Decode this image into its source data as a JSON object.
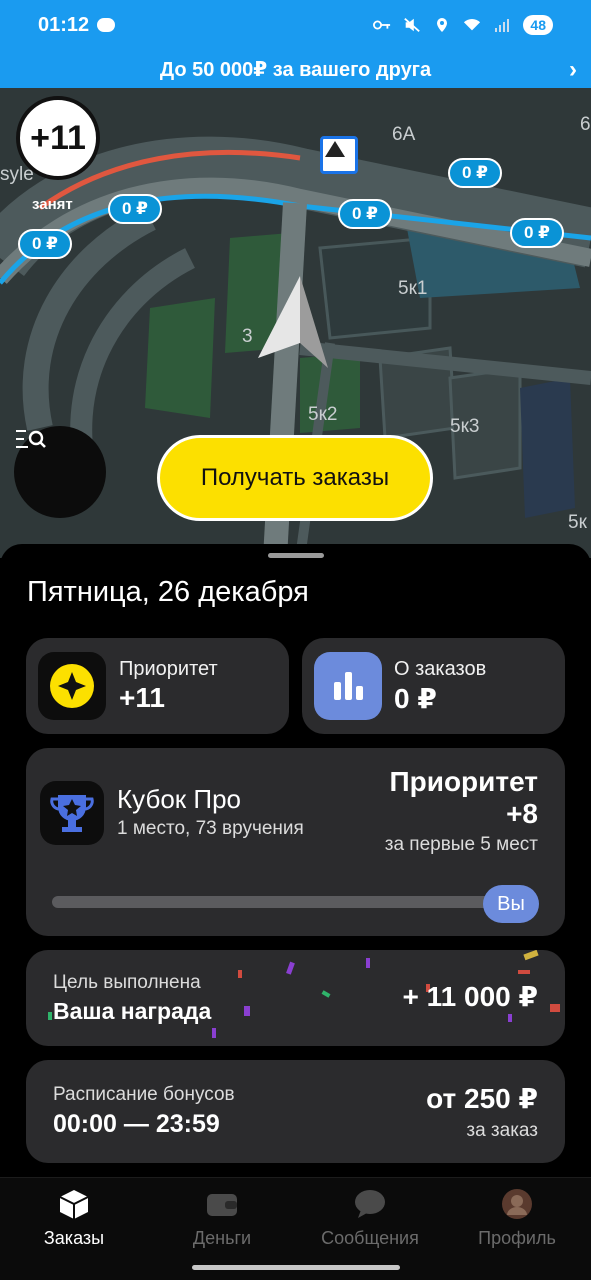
{
  "status_bar": {
    "time": "01:12",
    "battery": "48"
  },
  "promo": {
    "text": "До 50 000₽ за вашего друга"
  },
  "map": {
    "priority_badge": "+11",
    "status_label": "занят",
    "street_labels": [
      "6А",
      "6",
      "5к1",
      "3",
      "5к2",
      "5к3",
      "5к",
      "syle"
    ],
    "price_pills": [
      "0 ₽",
      "0 ₽",
      "0 ₽",
      "0 ₽",
      "0 ₽"
    ],
    "get_orders_button": "Получать заказы"
  },
  "sheet": {
    "date": "Пятница, 26 декабря",
    "priority_card": {
      "label": "Приоритет",
      "value": "+11"
    },
    "orders_card": {
      "label": "О заказов",
      "value": "0 ₽"
    },
    "cup_card": {
      "title": "Кубок Про",
      "subtitle": "1 место, 73 вручения",
      "reward_title": "Приоритет",
      "reward_value": "+8",
      "reward_note": "за первые 5 мест",
      "you_label": "Вы"
    },
    "goal_card": {
      "title": "Цель выполнена",
      "subtitle": "Ваша награда",
      "amount": "+ 11 000 ₽"
    },
    "schedule_card": {
      "title": "Расписание бонусов",
      "time": "00:00 — 23:59",
      "amount": "от 250 ₽",
      "note": "за заказ"
    }
  },
  "tabs": [
    {
      "label": "Заказы",
      "icon": "box-icon"
    },
    {
      "label": "Деньги",
      "icon": "wallet-icon"
    },
    {
      "label": "Сообщения",
      "icon": "chat-icon"
    },
    {
      "label": "Профиль",
      "icon": "avatar-icon"
    }
  ],
  "colors": {
    "accent_blue": "#1a9bf0",
    "yellow": "#fce000",
    "card": "#2b2b2d"
  }
}
